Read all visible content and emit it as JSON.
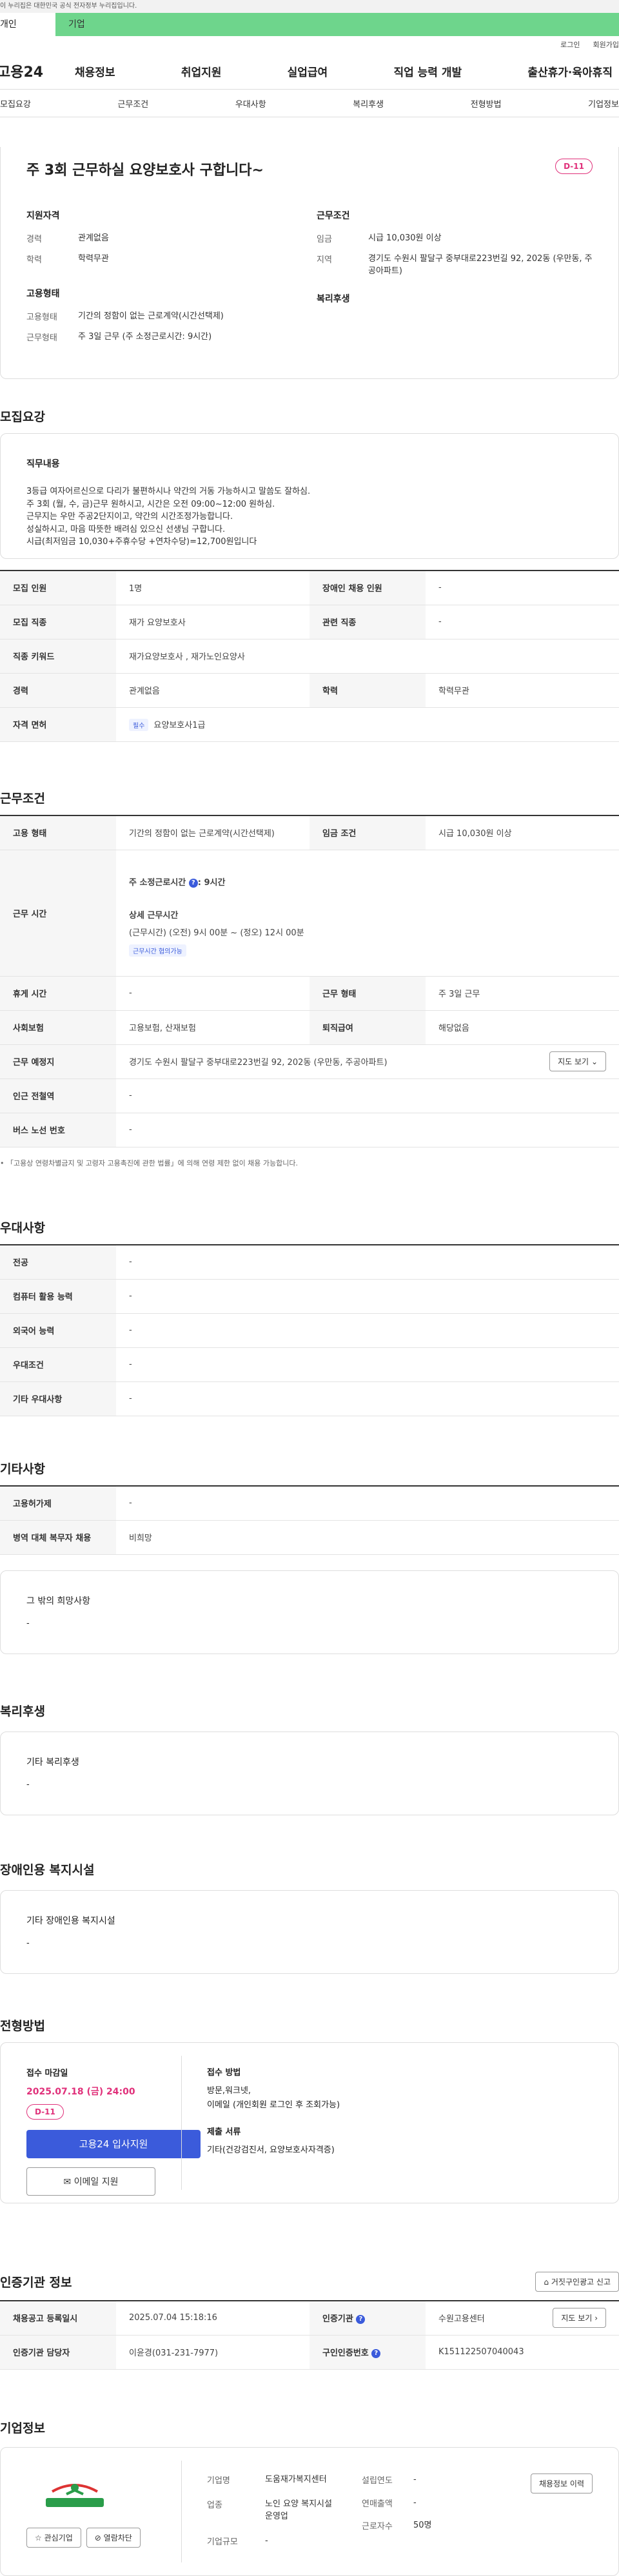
{
  "gov_banner": "이 누리집은 대한민국 공식 전자정부 누리집입니다.",
  "user_tabs": {
    "person": "개인",
    "company": "기업"
  },
  "util": {
    "login": "로그인",
    "join": "회원가입"
  },
  "logo": "고용24",
  "gnb": [
    "채용정보",
    "취업지원",
    "실업급여",
    "직업 능력 개발",
    "출산휴가·육아휴직"
  ],
  "anchors": [
    "모집요강",
    "근무조건",
    "우대사항",
    "복리후생",
    "전형방법",
    "기업정보"
  ],
  "summary": {
    "title": "주 3회 근무하실 요양보호사 구합니다~",
    "dday": "D-11",
    "qual_heading": "지원자격",
    "career_k": "경력",
    "career_v": "관계없음",
    "edu_k": "학력",
    "edu_v": "학력무관",
    "emp_heading": "고용형태",
    "emp_k": "고용형태",
    "emp_v": "기간의 정함이 없는 근로계약(시간선택제)",
    "work_k": "근무형태",
    "work_v": "주 3일 근무 (주 소정근로시간: 9시간)",
    "cond_heading": "근무조건",
    "wage_k": "임금",
    "wage_v": "시급 10,030원 이상",
    "area_k": "지역",
    "area_v": "경기도 수원시 팔달구 중부대로223번길 92, 202동 (우만동, 주공아파트)",
    "welfare_heading": "복리후생"
  },
  "recruit": {
    "title": "모집요강",
    "duty_heading": "직무내용",
    "duty_lines": [
      "3등급 여자어르신으로 다리가 불편하시나 약간의 거동 가능하시고 말씀도 잘하심.",
      "주 3회 (월, 수, 금)근무 원하시고, 시간은 오전 09:00~12:00 원하심.",
      "근무지는 우만 주공2단지이고, 약간의 시간조정가능합니다.",
      "성실하시고, 마음 따뜻한 배려심 있으신 선생님 구합니다.",
      "시급(최저임금 10,030+주휴수당 +연차수당)=12,700원입니다"
    ],
    "rows": {
      "count_k": "모집 인원",
      "count_v": "1명",
      "disabled_k": "장애인 채용 인원",
      "disabled_v": "-",
      "job_k": "모집 직종",
      "job_v": "재가 요양보호사",
      "related_k": "관련 직종",
      "related_v": "-",
      "keyword_k": "직종 키워드",
      "keyword_v": "재가요양보호사 , 재가노인요양사",
      "career_k": "경력",
      "career_v": "관계없음",
      "edu_k": "학력",
      "edu_v": "학력무관",
      "license_k": "자격 면허",
      "license_chip": "필수",
      "license_v": "요양보호사1급"
    }
  },
  "conditions": {
    "title": "근무조건",
    "emp_k": "고용 형태",
    "emp_v": "기간의 정함이 없는 근로계약(시간선택제)",
    "wage_k": "임금 조건",
    "wage_v": "시급 10,030원 이상",
    "time_k": "근무 시간",
    "hours_label": "주 소정근로시간",
    "hours_v": ": 9시간",
    "detail_label": "상세 근무시간",
    "detail_v": "(근무시간) (오전) 9시 00분 ~ (정오) 12시 00분",
    "adjust_chip": "근무시간 협의가능",
    "rest_k": "휴게 시간",
    "rest_v": "-",
    "type_k": "근무 형태",
    "type_v": "주 3일 근무",
    "insurance_k": "사회보험",
    "insurance_v": "고용보험, 산재보험",
    "retire_k": "퇴직급여",
    "retire_v": "해당없음",
    "place_k": "근무 예정지",
    "place_v": "경기도 수원시 팔달구 중부대로223번길 92, 202동 (우만동, 주공아파트)",
    "map_btn": "지도 보기",
    "subway_k": "인근 전철역",
    "subway_v": "-",
    "bus_k": "버스 노선 번호",
    "bus_v": "-",
    "note": "「고용상 연령차별금지 및 고령자 고용촉진에 관한 법률」에 의해 연령 제한 없이 채용 가능합니다."
  },
  "preferences": {
    "title": "우대사항",
    "rows": [
      {
        "k": "전공",
        "v": "-"
      },
      {
        "k": "컴퓨터 활용 능력",
        "v": "-"
      },
      {
        "k": "외국어 능력",
        "v": "-"
      },
      {
        "k": "우대조건",
        "v": "-"
      },
      {
        "k": "기타 우대사항",
        "v": "-"
      }
    ]
  },
  "other": {
    "title": "기타사항",
    "rows": [
      {
        "k": "고용허가제",
        "v": "-"
      },
      {
        "k": "병역 대체 복무자 채용",
        "v": "비희망"
      }
    ],
    "extra_heading": "그 밖의 희망사항",
    "extra_v": "-"
  },
  "welfare": {
    "title": "복리후생",
    "heading": "기타 복리후생",
    "v": "-"
  },
  "disabled": {
    "title": "장애인용 복지시설",
    "heading": "기타 장애인용 복지시설",
    "v": "-"
  },
  "selection": {
    "title": "전형방법",
    "deadline_label": "접수 마감일",
    "deadline_v": "2025.07.18 (금) 24:00",
    "dday": "D-11",
    "apply_btn": "고용24 입사지원",
    "email_btn": "이메일 지원",
    "method_heading": "접수 방법",
    "method_v": "방문,워크넷,",
    "method_v2": "이메일 (개인회원 로그인 후 조회가능)",
    "docs_heading": "제출 서류",
    "docs_v": "기타(건강검진서, 요양보호사자격증)"
  },
  "cert": {
    "title": "인증기관 정보",
    "report_btn": "거짓구인광고 신고",
    "reg_k": "채용공고 등록일시",
    "reg_v": "2025.07.04 15:18:16",
    "org_k": "인증기관",
    "org_v": "수원고용센터",
    "map_btn": "지도 보기",
    "manager_k": "인증기관 담당자",
    "manager_v": "이윤경(031-231-7977)",
    "id_k": "구인인증번호",
    "id_v": "K151122507040043"
  },
  "company": {
    "title": "기업정보",
    "logo_text": "도움재가복지센터",
    "fav_btn": "관심기업",
    "block_btn": "열람차단",
    "name_k": "기업명",
    "name_v": "도움재가복지센터",
    "industry_k": "업종",
    "industry_v": "노인 요양 복지시설 운영업",
    "size_k": "기업규모",
    "size_v": "-",
    "year_k": "설립연도",
    "year_v": "-",
    "sales_k": "연매출액",
    "sales_v": "-",
    "emp_k": "근로자수",
    "emp_v": "50명",
    "jobs_btn": "채용정보 이력"
  }
}
